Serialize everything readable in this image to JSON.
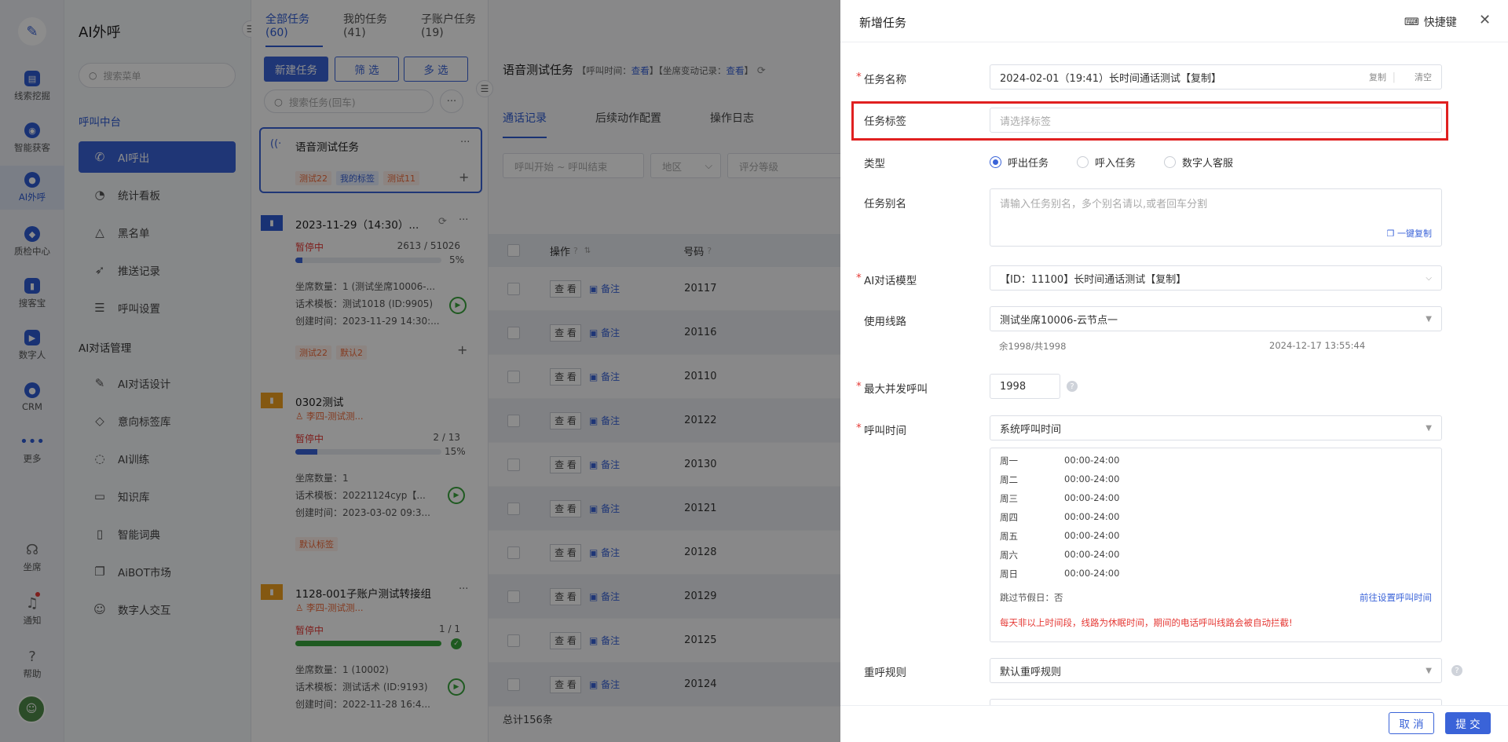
{
  "rail": {
    "items": [
      {
        "label": "线索挖掘",
        "icon": "lead-icon"
      },
      {
        "label": "智能获客",
        "icon": "acquire-icon"
      },
      {
        "label": "AI外呼",
        "icon": "ai-call-icon"
      },
      {
        "label": "质检中心",
        "icon": "quality-icon"
      },
      {
        "label": "搜客宝",
        "icon": "search-customer-icon"
      },
      {
        "label": "数字人",
        "icon": "digital-human-icon"
      },
      {
        "label": "CRM",
        "icon": "crm-icon"
      },
      {
        "label": "更多",
        "icon": "more-icon"
      }
    ],
    "bottom": [
      {
        "label": "坐席",
        "icon": "headset-icon"
      },
      {
        "label": "通知",
        "icon": "bell-icon"
      },
      {
        "label": "帮助",
        "icon": "help-icon"
      }
    ]
  },
  "menu": {
    "title": "AI外呼",
    "search_placeholder": "搜索菜单",
    "group1": "呼叫中台",
    "group1_items": [
      "AI呼出",
      "统计看板",
      "黑名单",
      "推送记录",
      "呼叫设置"
    ],
    "group2": "AI对话管理",
    "group2_items": [
      "AI对话设计",
      "意向标签库",
      "AI训练",
      "知识库",
      "智能词典",
      "AiBOT市场",
      "数字人交互"
    ]
  },
  "tasks": {
    "tabs": [
      "全部任务(60)",
      "我的任务(41)",
      "子账户任务(19)"
    ],
    "new_btn": "新建任务",
    "filter_btn": "筛 选",
    "multi_btn": "多 选",
    "search_placeholder": "搜索任务(回车)",
    "cards": [
      {
        "title": "语音测试任务",
        "tags": [
          "测试22",
          "我的标签",
          "测试11"
        ]
      },
      {
        "title": "2023-11-29（14:30）...",
        "status": "暂停中",
        "progress": "2613 / 51026",
        "pct": "5%",
        "seats": "坐席数量：1 (测试坐席10006-...",
        "tpl": "话术模板：测试1018 (ID:9905)",
        "created": "创建时间：2023-11-29 14:30:...",
        "tags": [
          "测试22",
          "默认2"
        ]
      },
      {
        "title": "0302测试",
        "owner": "李四-测试测...",
        "status": "暂停中",
        "progress": "2 / 13",
        "pct": "15%",
        "seats": "坐席数量：1",
        "tpl": "话术模板：20221124cyp【...",
        "created": "创建时间：2023-03-02 09:3...",
        "tags": [
          "默认标签"
        ]
      },
      {
        "title": "1128-001子账户测试转接组",
        "owner": "李四-测试测...",
        "status": "暂停中",
        "progress": "1 / 1",
        "seats": "坐席数量：1 (10002)",
        "tpl": "话术模板：测试话术 (ID:9193)",
        "created": "创建时间：2022-11-28 16:4..."
      }
    ]
  },
  "detail": {
    "title": "语音测试任务",
    "sub1": "【呼叫时间：",
    "sub1_link": "查看",
    "sub2": "】【坐席变动记录：",
    "sub2_link": "查看",
    "sub_end": "】",
    "tabs": [
      "通话记录",
      "后续动作配置",
      "操作日志"
    ],
    "filters": [
      "呼叫开始 ~ 呼叫结束",
      "地区",
      "评分等级"
    ],
    "columns": [
      "操作",
      "号码"
    ],
    "view_label": "查 看",
    "note_label": "备注",
    "rows": [
      "20117",
      "20116",
      "20110",
      "20122",
      "20130",
      "20121",
      "20128",
      "20129",
      "20125",
      "20124"
    ],
    "total": "总计156条"
  },
  "drawer": {
    "title": "新增任务",
    "shortcut": "快捷键",
    "fields": {
      "name_label": "任务名称",
      "name_value": "2024-02-01（19:41）长时间通话测试【复制】",
      "copy": "复制",
      "clear": "清空",
      "tag_label": "任务标签",
      "tag_placeholder": "请选择标签",
      "type_label": "类型",
      "type_options": [
        "呼出任务",
        "呼入任务",
        "数字人客服"
      ],
      "alias_label": "任务别名",
      "alias_placeholder": "请输入任务别名，多个别名请以,或者回车分割",
      "one_copy": "一键复制",
      "model_label": "AI对话模型",
      "model_value": "【ID：11100】长时间通话测试【复制】",
      "line_label": "使用线路",
      "line_value": "测试坐席10006-云节点一",
      "line_remain": "余1998/共1998",
      "line_date": "2024-12-17 13:55:44",
      "concurrency_label": "最大并发呼叫",
      "concurrency_value": "1998",
      "calltime_label": "呼叫时间",
      "calltime_value": "系统呼叫时间",
      "schedule": [
        {
          "day": "周一",
          "time": "00:00-24:00"
        },
        {
          "day": "周二",
          "time": "00:00-24:00"
        },
        {
          "day": "周三",
          "time": "00:00-24:00"
        },
        {
          "day": "周四",
          "time": "00:00-24:00"
        },
        {
          "day": "周五",
          "time": "00:00-24:00"
        },
        {
          "day": "周六",
          "time": "00:00-24:00"
        },
        {
          "day": "周日",
          "time": "00:00-24:00"
        }
      ],
      "skip_holiday": "跳过节假日：否",
      "goto_set": "前往设置呼叫时间",
      "warning": "每天非以上时间段，线路为休眠时间，期间的电话呼叫线路会被自动拦截!",
      "recall_label": "重呼规则",
      "recall_value": "默认重呼规则"
    },
    "cancel": "取 消",
    "submit": "提 交"
  }
}
